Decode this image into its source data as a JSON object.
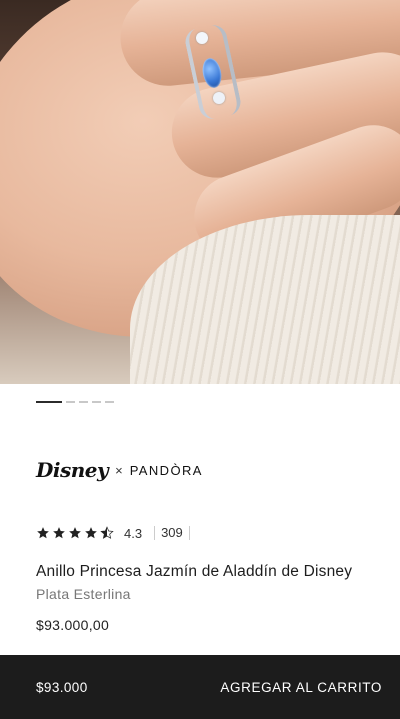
{
  "gallery": {
    "image_alt": "Anillo Princesa Jazmín en mano",
    "slides_total": 5,
    "active_slide": 1
  },
  "brand": {
    "disney": "Disney",
    "separator": "×",
    "pandora": "PANDÒRA"
  },
  "rating": {
    "value": "4.3",
    "stars_filled": 4.3,
    "stars_total": 5,
    "reviews": "309",
    "star_color": "#222222"
  },
  "product": {
    "title": "Anillo Princesa Jazmín de Aladdín de Disney",
    "material": "Plata Esterlina",
    "price": "$93.000,00"
  },
  "bottom_bar": {
    "price": "$93.000",
    "cta": "AGREGAR AL CARRITO",
    "background": "#1c1c1c"
  }
}
